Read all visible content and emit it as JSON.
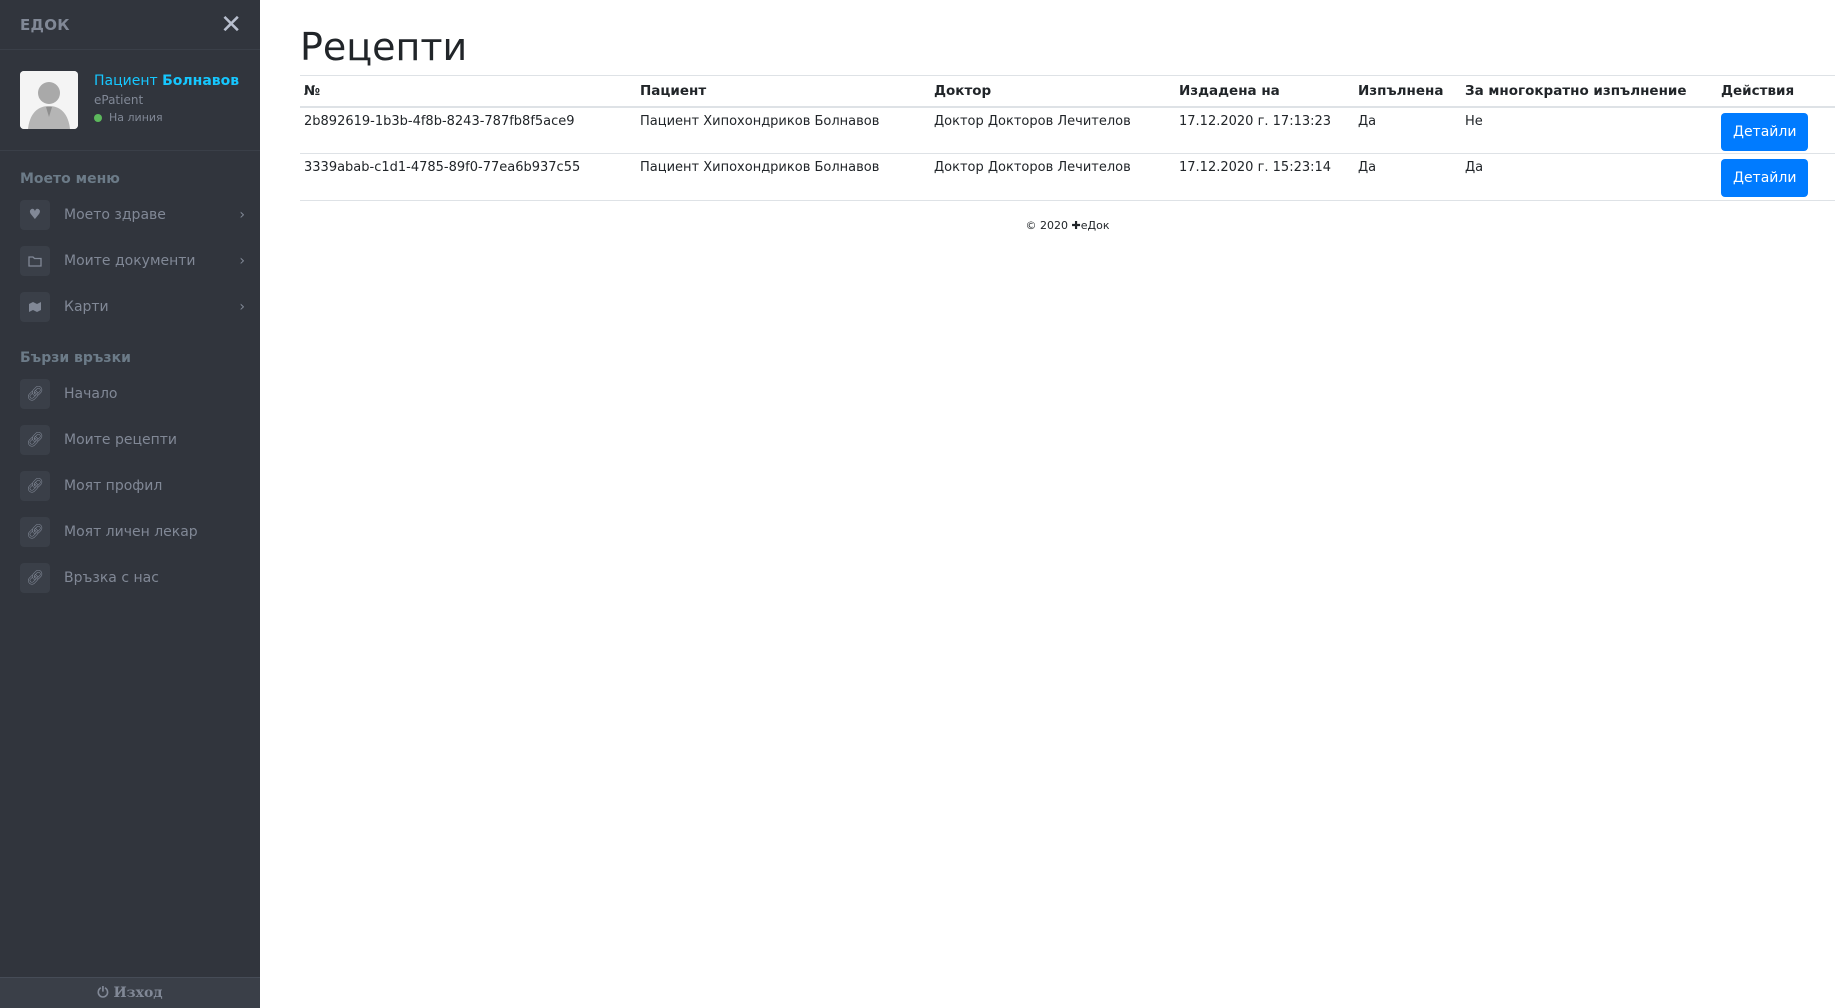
{
  "sidebar": {
    "brand": "ЕДОК",
    "user": {
      "first_name": "Пациент",
      "last_name": "Болнавов",
      "role": "ePatient",
      "status": "На линия"
    },
    "my_menu_header": "Моето меню",
    "my_menu": [
      {
        "label": "Моето здраве",
        "icon": "heart-icon"
      },
      {
        "label": "Моите документи",
        "icon": "folder-icon"
      },
      {
        "label": "Карти",
        "icon": "map-icon"
      }
    ],
    "quick_links_header": "Бързи връзки",
    "quick_links": [
      {
        "label": "Начало",
        "icon": "link-icon"
      },
      {
        "label": "Моите рецепти",
        "icon": "link-icon"
      },
      {
        "label": "Моят профил",
        "icon": "link-icon"
      },
      {
        "label": "Моят личен лекар",
        "icon": "link-icon"
      },
      {
        "label": "Връзка с нас",
        "icon": "link-icon"
      }
    ],
    "logout": "Изход"
  },
  "main": {
    "title": "Рецепти",
    "table": {
      "columns": [
        "№",
        "Пациент",
        "Доктор",
        "Издадена на",
        "Изпълнена",
        "За многократно изпълнение",
        "Действия"
      ],
      "rows": [
        {
          "id": "2b892619-1b3b-4f8b-8243-787fb8f5ace9",
          "patient": "Пациент Хипохондриков Болнавов",
          "doctor": "Доктор Докторов Лечителов",
          "issued": "17.12.2020 г. 17:13:23",
          "fulfilled": "Да",
          "repeatable": "Не",
          "action": "Детайли"
        },
        {
          "id": "3339abab-c1d1-4785-89f0-77ea6b937c55",
          "patient": "Пациент Хипохондриков Болнавов",
          "doctor": "Доктор Докторов Лечителов",
          "issued": "17.12.2020 г. 15:23:14",
          "fulfilled": "Да",
          "repeatable": "Да",
          "action": "Детайли"
        }
      ]
    },
    "footer": {
      "year": "© 2020",
      "brand": "еДок"
    }
  },
  "colors": {
    "sidebar_bg": "#31353d",
    "accent": "#16c7ff",
    "button": "#007bff",
    "status_online": "#5cb85c"
  }
}
